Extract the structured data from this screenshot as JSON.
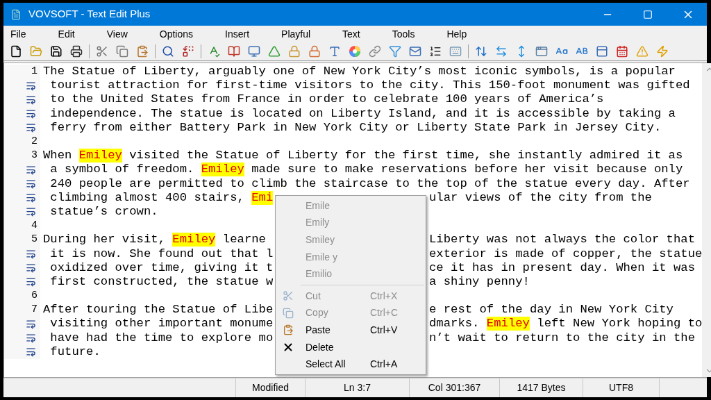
{
  "window": {
    "title": "VOVSOFT - Text Edit Plus"
  },
  "menu_bar": [
    "File",
    "Edit",
    "View",
    "Options",
    "Insert",
    "Playful",
    "Text",
    "Tools",
    "Help"
  ],
  "editor": {
    "lines": [
      {
        "kind": "number",
        "number": "1",
        "parts": [
          {
            "text": "The Statue of Liberty, arguably one of New York City’s most iconic symbols, is a popular",
            "highlighted": false
          }
        ]
      },
      {
        "kind": "wrap",
        "parts": [
          {
            "text": " tourist attraction for first-time visitors to the city. This 150-foot monument was gifted",
            "highlighted": false
          }
        ]
      },
      {
        "kind": "wrap",
        "parts": [
          {
            "text": " to the United States from France in order to celebrate 100 years of America’s",
            "highlighted": false
          }
        ]
      },
      {
        "kind": "wrap",
        "parts": [
          {
            "text": " independence. The statue is located on Liberty Island, and it is accessible by taking a",
            "highlighted": false
          }
        ]
      },
      {
        "kind": "wrap",
        "parts": [
          {
            "text": " ferry from either Battery Park in New York City or Liberty State Park in Jersey City.",
            "highlighted": false
          }
        ]
      },
      {
        "kind": "number",
        "number": "2"
      },
      {
        "kind": "number",
        "number": "3",
        "parts": [
          {
            "text": "When ",
            "highlighted": false
          },
          {
            "text": "Emiley",
            "highlighted": true
          },
          {
            "text": " visited the Statue of Liberty for the first time, she instantly admired it as",
            "highlighted": false
          }
        ]
      },
      {
        "kind": "wrap",
        "parts": [
          {
            "text": " a symbol of freedom. ",
            "highlighted": false
          },
          {
            "text": "Emiley",
            "highlighted": true
          },
          {
            "text": " made sure to make reservations before her visit because only",
            "highlighted": false
          }
        ]
      },
      {
        "kind": "wrap",
        "parts": [
          {
            "text": " 240 people are permitted to climb the staircase to the top of the statue every day. After",
            "highlighted": false
          }
        ]
      },
      {
        "kind": "wrap",
        "parts": [
          {
            "text": " climbing almost 400 stairs, ",
            "highlighted": false
          },
          {
            "text": "Emi",
            "highlighted": true
          }
        ],
        "after_menu": [
          {
            "text": "ular views of the city from the",
            "highlighted": false
          }
        ]
      },
      {
        "kind": "wrap",
        "parts": [
          {
            "text": " statue’s crown.",
            "highlighted": false
          }
        ]
      },
      {
        "kind": "number",
        "number": "4"
      },
      {
        "kind": "number",
        "number": "5",
        "parts": [
          {
            "text": "During her visit, ",
            "highlighted": false
          },
          {
            "text": "Emiley",
            "highlighted": true
          },
          {
            "text": " learne",
            "highlighted": false
          }
        ],
        "after_menu": [
          {
            "text": "Liberty was not always the color that",
            "highlighted": false
          }
        ]
      },
      {
        "kind": "wrap",
        "parts": [
          {
            "text": " it is now. She found out that l",
            "highlighted": false
          }
        ],
        "after_menu": [
          {
            "text": "exterior is made of copper, the statue",
            "highlighted": false
          }
        ]
      },
      {
        "kind": "wrap",
        "parts": [
          {
            "text": " oxidized over time, giving it t",
            "highlighted": false
          }
        ],
        "after_menu": [
          {
            "text": "ce it has in present day. When it was",
            "highlighted": false
          }
        ]
      },
      {
        "kind": "wrap",
        "parts": [
          {
            "text": " first constructed, the statue w",
            "highlighted": false
          }
        ],
        "after_menu": [
          {
            "text": "a shiny penny!",
            "highlighted": false
          }
        ]
      },
      {
        "kind": "number",
        "number": "6"
      },
      {
        "kind": "number",
        "number": "7",
        "parts": [
          {
            "text": "After touring the Statue of Libe",
            "highlighted": false
          }
        ],
        "after_menu": [
          {
            "text": "e rest of the day in New York City",
            "highlighted": false
          }
        ]
      },
      {
        "kind": "wrap",
        "parts": [
          {
            "text": " visiting other important monume",
            "highlighted": false
          }
        ],
        "after_menu": [
          {
            "text": "dmarks. ",
            "highlighted": false
          },
          {
            "text": "Emiley",
            "highlighted": true
          },
          {
            "text": " left New York hoping to",
            "highlighted": false
          }
        ]
      },
      {
        "kind": "wrap",
        "parts": [
          {
            "text": " have had the time to explore mo",
            "highlighted": false
          }
        ],
        "after_menu": [
          {
            "text": "n’t wait to return to the city in the",
            "highlighted": false
          }
        ]
      },
      {
        "kind": "wrap",
        "parts": [
          {
            "text": " future.",
            "highlighted": false
          }
        ]
      }
    ]
  },
  "context_menu": {
    "suggestions": [
      {
        "label": "Emile",
        "disabled": true
      },
      {
        "label": "Emily",
        "disabled": true
      },
      {
        "label": "Smiley",
        "disabled": true
      },
      {
        "label": "Emile y",
        "disabled": true
      },
      {
        "label": "Emilio",
        "disabled": true
      }
    ],
    "items": [
      {
        "kind": "cut",
        "label": "Cut",
        "shortcut": "Ctrl+X",
        "disabled": true
      },
      {
        "kind": "copy",
        "label": "Copy",
        "shortcut": "Ctrl+C",
        "disabled": true
      },
      {
        "kind": "paste",
        "label": "Paste",
        "shortcut": "Ctrl+V",
        "disabled": false
      },
      {
        "kind": "delete",
        "label": "Delete",
        "disabled": false
      },
      {
        "kind": "select_all",
        "label": "Select All",
        "shortcut": "Ctrl+A",
        "disabled": false
      }
    ]
  },
  "status_bar": [
    "Modified",
    "Ln 3:7",
    "Col 301:367",
    "1417 Bytes",
    "UTF8"
  ]
}
